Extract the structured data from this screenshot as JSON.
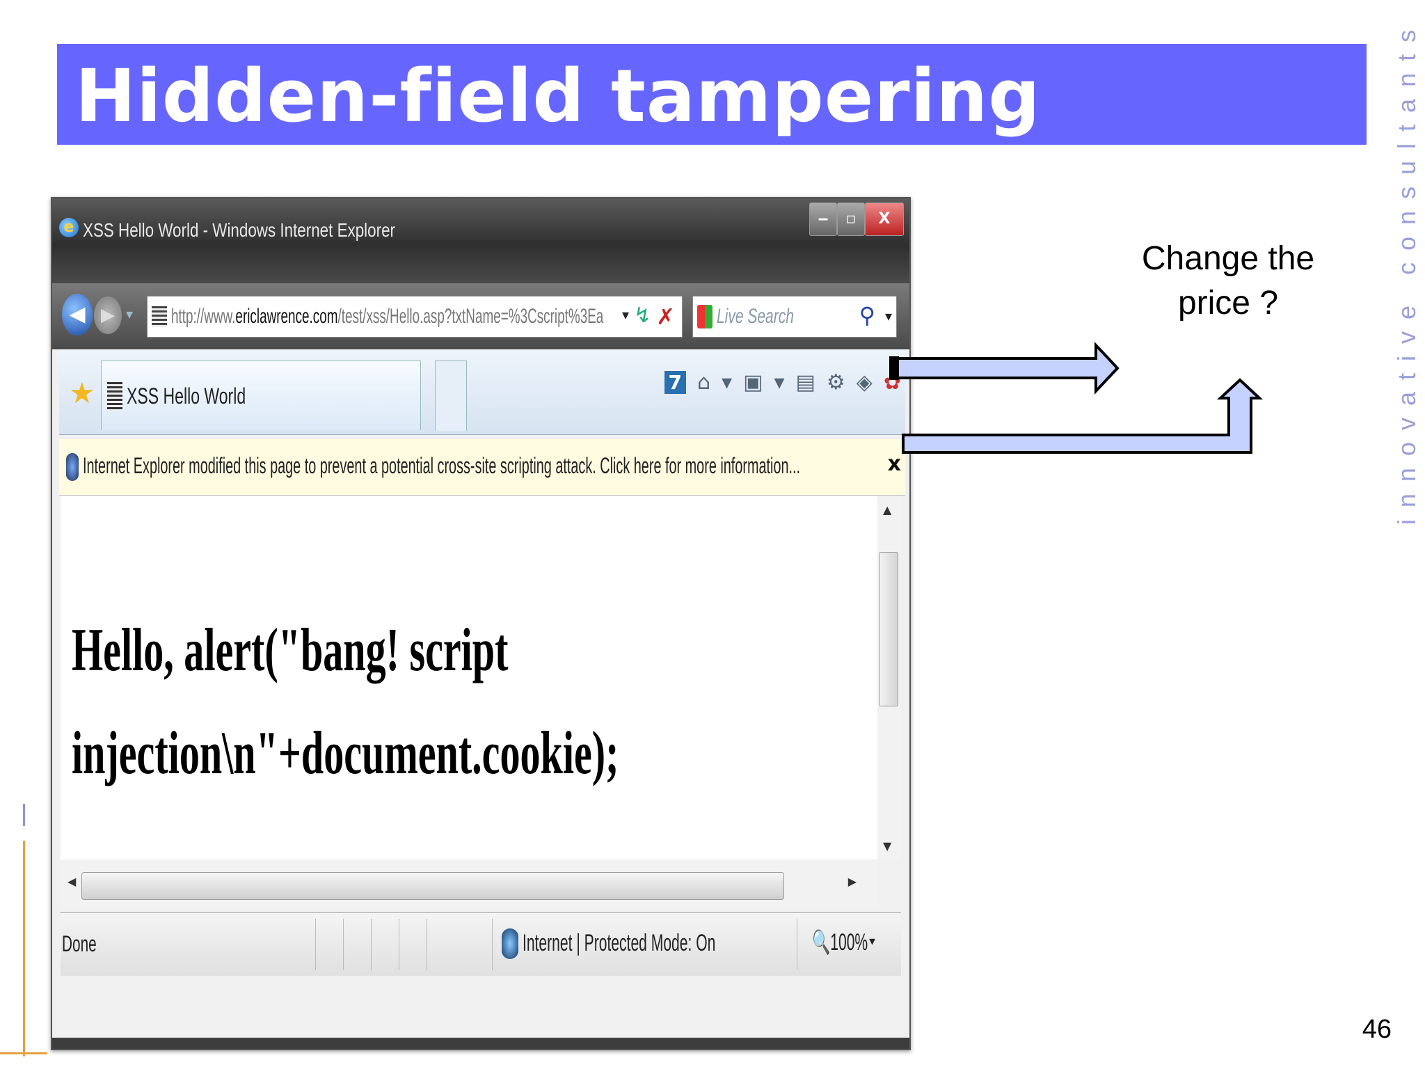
{
  "slide": {
    "title": "Hidden-field tampering",
    "tagline": "innovative consultants",
    "page_number": "46",
    "callout": "Change the price ?"
  },
  "colors": {
    "title_bar": "#6666ff",
    "arrow_fill": "#c5d2ff",
    "tagline": "#9aa0d8",
    "accent_line": "#e6a040"
  },
  "browser": {
    "window_title": "XSS Hello World - Windows Internet Explorer",
    "address_prefix": "http://www.",
    "address_domain": "ericlawrence.com",
    "address_path": "/test/xss/Hello.asp?txtName=%3Cscript%3Ea",
    "search_placeholder": "Live Search",
    "tab_title": "XSS Hello World",
    "infobar_text": "Internet Explorer modified this page to prevent a potential cross-site scripting attack.  Click here for more information...",
    "page_text": "Hello, alert(\"bang! script\ninjection\\n\"+document.cookie);",
    "status_text": "Done",
    "zone_text": "Internet | Protected Mode: On",
    "zoom_text": "100%"
  },
  "icons": {
    "ie_logo": "e",
    "back": "◀",
    "forward": "▶",
    "dropdown": "▾",
    "refresh": "↯",
    "stop": "✗",
    "search": "⚲",
    "favorites": "★",
    "minimize": "‒",
    "maximize": "▫",
    "close": "X",
    "infobar_close": "x",
    "scroll_up": "▲",
    "scroll_down": "▼",
    "scroll_left": "◀",
    "scroll_right": "▶"
  }
}
